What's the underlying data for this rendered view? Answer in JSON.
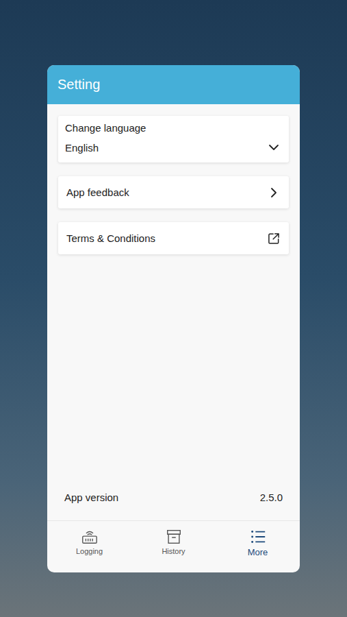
{
  "header": {
    "title": "Setting"
  },
  "settings": [
    {
      "kind": "dropdown",
      "label": "Change language",
      "value": "English"
    },
    {
      "kind": "link",
      "label": "App feedback"
    },
    {
      "kind": "external",
      "label": "Terms & Conditions"
    }
  ],
  "app_version": {
    "label": "App version",
    "value": "2.5.0"
  },
  "tabs": [
    {
      "label": "Logging",
      "selected": false
    },
    {
      "label": "History",
      "selected": false
    },
    {
      "label": "More",
      "selected": true
    }
  ]
}
